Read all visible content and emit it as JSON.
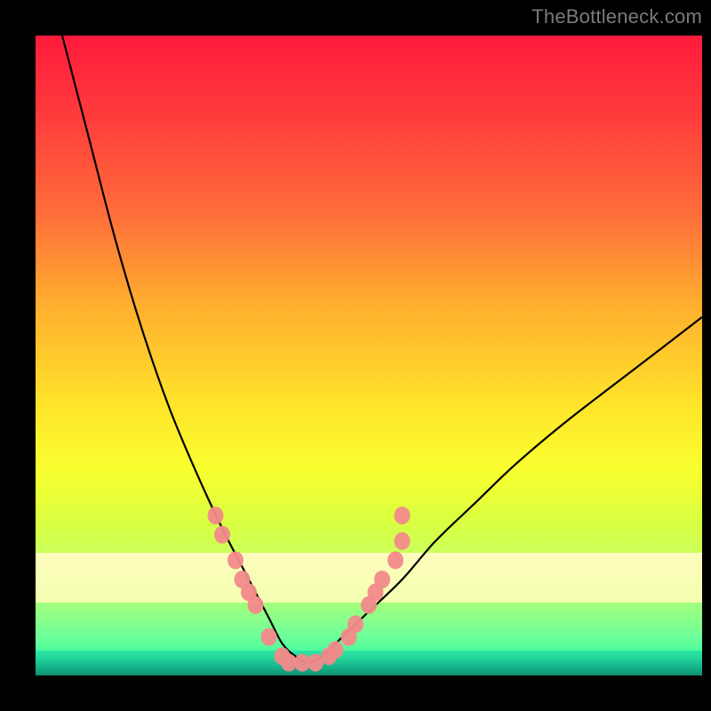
{
  "watermark": "TheBottleneck.com",
  "colors": {
    "frame": "#000000",
    "gradient_top": "#ff1a3c",
    "gradient_bottom": "#18f4a0",
    "cream_band": "#fdfcbc",
    "green_band": "#18b98e",
    "curve_stroke": "#000000",
    "marker_fill": "#f28a8a",
    "marker_stroke": "#f28a8a"
  },
  "chart_data": {
    "type": "line",
    "title": "",
    "xlabel": "",
    "ylabel": "",
    "xlim": [
      0,
      100
    ],
    "ylim": [
      0,
      100
    ],
    "grid": false,
    "legend": false,
    "comment": "Axes have no tick labels; values are relative positions (0–100) estimated from pixels. y=0 at bottom of plot, y=100 at top. Curve resembles an asymmetric V / bottleneck shape with minimum near x≈40, y≈2.",
    "series": [
      {
        "name": "bottleneck-curve",
        "x": [
          4,
          8,
          12,
          16,
          20,
          24,
          28,
          32,
          35,
          37,
          39,
          41,
          43,
          46,
          50,
          55,
          60,
          66,
          72,
          80,
          90,
          100
        ],
        "y": [
          100,
          84,
          68,
          54,
          42,
          32,
          23,
          15,
          9,
          5,
          3,
          2,
          3,
          6,
          10,
          15,
          21,
          27,
          33,
          40,
          48,
          56
        ]
      }
    ],
    "markers": {
      "name": "highlighted-points",
      "comment": "Salmon/pink blobs clustered on the lower arms and valley of the curve, approximate positions.",
      "points": [
        {
          "x": 27,
          "y": 25
        },
        {
          "x": 28,
          "y": 22
        },
        {
          "x": 30,
          "y": 18
        },
        {
          "x": 31,
          "y": 15
        },
        {
          "x": 32,
          "y": 13
        },
        {
          "x": 33,
          "y": 11
        },
        {
          "x": 35,
          "y": 6
        },
        {
          "x": 37,
          "y": 3
        },
        {
          "x": 38,
          "y": 2
        },
        {
          "x": 40,
          "y": 2
        },
        {
          "x": 42,
          "y": 2
        },
        {
          "x": 44,
          "y": 3
        },
        {
          "x": 45,
          "y": 4
        },
        {
          "x": 47,
          "y": 6
        },
        {
          "x": 48,
          "y": 8
        },
        {
          "x": 50,
          "y": 11
        },
        {
          "x": 51,
          "y": 13
        },
        {
          "x": 52,
          "y": 15
        },
        {
          "x": 54,
          "y": 18
        },
        {
          "x": 55,
          "y": 21
        },
        {
          "x": 55,
          "y": 25
        }
      ]
    }
  }
}
